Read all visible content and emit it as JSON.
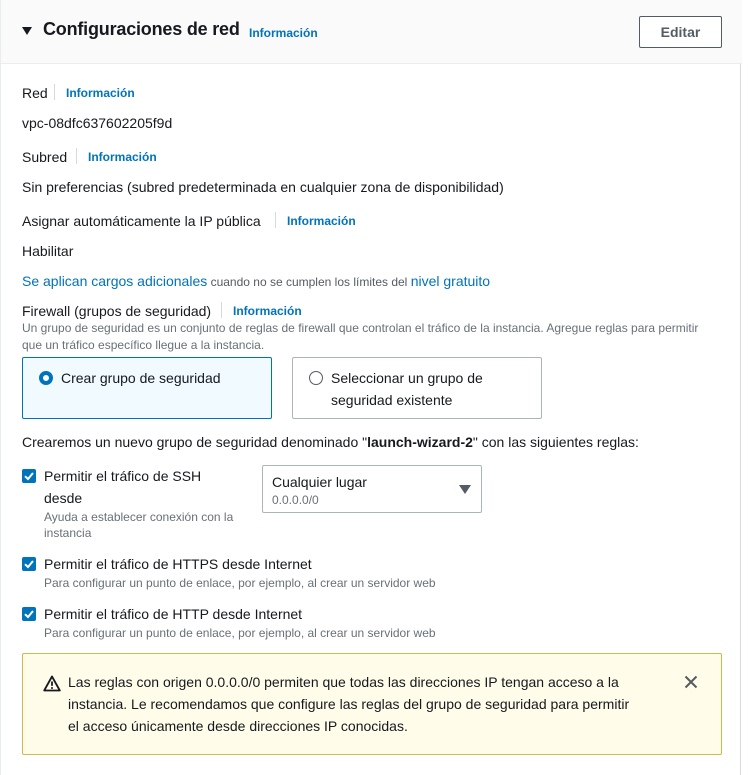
{
  "header": {
    "title": "Configuraciones de red",
    "info_label": "Información",
    "edit_label": "Editar"
  },
  "network": {
    "label": "Red",
    "info_label": "Información",
    "value": "vpc-08dfc637602205f9d"
  },
  "subnet": {
    "label": "Subred",
    "info_label": "Información",
    "value": "Sin preferencias (subred predeterminada en cualquier zona de disponibilidad)"
  },
  "public_ip": {
    "label": "Asignar automáticamente la IP pública",
    "info_label": "Información",
    "value": "Habilitar"
  },
  "charges": {
    "link1": "Se aplican cargos adicionales",
    "middle": " cuando no se cumplen los límites del ",
    "link2": "nivel gratuito"
  },
  "firewall": {
    "label": "Firewall (grupos de seguridad)",
    "info_label": "Información",
    "description_line1": "Un grupo de seguridad es un conjunto de reglas de firewall que controlan el tráfico de la instancia. Agregue reglas para permitir",
    "description_line2": "que un tráfico específico llegue a la instancia.",
    "option_create": "Crear grupo de seguridad",
    "option_select_line1": "Seleccionar un grupo de",
    "option_select_line2": "seguridad existente",
    "selected_option": "create"
  },
  "rules_intro": {
    "prefix": "Crearemos un nuevo grupo de seguridad denominado \"",
    "name": "launch-wizard-2",
    "suffix": "\" con las siguientes reglas:"
  },
  "rules": {
    "ssh": {
      "label_line1": "Permitir el tráfico de SSH",
      "label_line2": "desde",
      "help_line1": "Ayuda a establecer conexión con la",
      "help_line2": "instancia",
      "checked": true,
      "source_value": "Cualquier lugar",
      "source_sub": "0.0.0.0/0"
    },
    "https": {
      "label": "Permitir el tráfico de HTTPS desde Internet",
      "help": "Para configurar un punto de enlace, por ejemplo, al crear un servidor web",
      "checked": true
    },
    "http": {
      "label": "Permitir el tráfico de HTTP desde Internet",
      "help": "Para configurar un punto de enlace, por ejemplo, al crear un servidor web",
      "checked": true
    }
  },
  "alert": {
    "line1": "Las reglas con origen 0.0.0.0/0 permiten que todas las direcciones IP tengan acceso a la",
    "line2": "instancia. Le recomendamos que configure las reglas del grupo de seguridad para permitir",
    "line3": "el acceso únicamente desde direcciones IP conocidas.",
    "icon": "warning-icon",
    "close_icon": "close-icon"
  },
  "colors": {
    "link": "#0073bb",
    "alert_bg": "#fffce9",
    "alert_border": "#d3b84b",
    "selected_card_bg": "#f1faff"
  }
}
